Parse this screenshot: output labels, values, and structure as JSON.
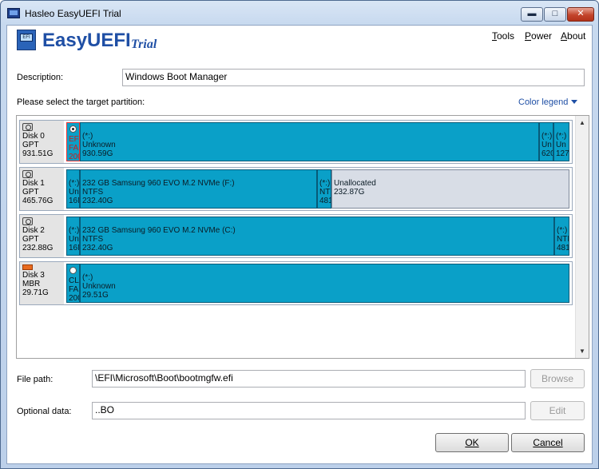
{
  "window": {
    "title": "Hasleo EasyUEFI Trial",
    "min_glyph": "▬",
    "max_glyph": "□",
    "close_glyph": "✕"
  },
  "header": {
    "logo_text": "EFI",
    "app_name": "EasyUEFI",
    "edition": "Trial",
    "menu": [
      {
        "label": "Tools",
        "underline": "T",
        "rest": "ools"
      },
      {
        "label": "Power",
        "underline": "P",
        "rest": "ower"
      },
      {
        "label": "About",
        "underline": "A",
        "rest": "bout"
      }
    ]
  },
  "form": {
    "description_label": "Description:",
    "description_value": "Windows Boot Manager",
    "select_partition_label": "Please select the target partition:",
    "color_legend_label": "Color legend",
    "file_path_label": "File path:",
    "file_path_value": "\\EFI\\Microsoft\\Boot\\bootmgfw.efi",
    "browse_label": "Browse",
    "optional_data_label": "Optional data:",
    "optional_data_value": "..BO",
    "edit_label": "Edit",
    "ok_label": "OK",
    "cancel_label": "Cancel"
  },
  "disks": [
    {
      "name": "Disk 0",
      "style": "GPT",
      "size": "931.51G",
      "icon": "hdd-icon",
      "partitions": [
        {
          "l1": "EFI",
          "l2": "FA",
          "l3": "200",
          "selected": true,
          "radio": "on"
        },
        {
          "l1": "(*:)",
          "l2": "Unknown",
          "l3": "930.59G"
        },
        {
          "l1": "(*:)",
          "l2": "Un",
          "l3": "620"
        },
        {
          "l1": "(*:)",
          "l2": "Un",
          "l3": "127"
        }
      ]
    },
    {
      "name": "Disk 1",
      "style": "GPT",
      "size": "465.76G",
      "icon": "hdd-icon",
      "partitions": [
        {
          "l1": "(*:)",
          "l2": "Un",
          "l3": "16N"
        },
        {
          "l1": "232 GB Samsung 960 EVO M.2 NVMe  (F:)",
          "l2": "NTFS",
          "l3": "232.40G"
        },
        {
          "l1": "(*:)",
          "l2": "NT",
          "l3": "481"
        },
        {
          "l1": "",
          "l2": "Unallocated",
          "l3": "232.87G",
          "unalloc": true
        }
      ]
    },
    {
      "name": "Disk 2",
      "style": "GPT",
      "size": "232.88G",
      "icon": "hdd-icon",
      "partitions": [
        {
          "l1": "(*:)",
          "l2": "Un",
          "l3": "16N"
        },
        {
          "l1": "232 GB Samsung 960 EVO M.2 NVMe  (C:)",
          "l2": "NTFS",
          "l3": "232.40G"
        },
        {
          "l1": "(*:)",
          "l2": "NTI",
          "l3": "481"
        }
      ]
    },
    {
      "name": "Disk 3",
      "style": "MBR",
      "size": "29.71G",
      "icon": "usb-drive-icon",
      "partitions": [
        {
          "l1": "CLI",
          "l2": "FA",
          "l3": "200",
          "radio": "off"
        },
        {
          "l1": "(*:)",
          "l2": "Unknown",
          "l3": "29.51G"
        }
      ]
    }
  ],
  "scroll": {
    "up": "▲",
    "down": "▼"
  }
}
